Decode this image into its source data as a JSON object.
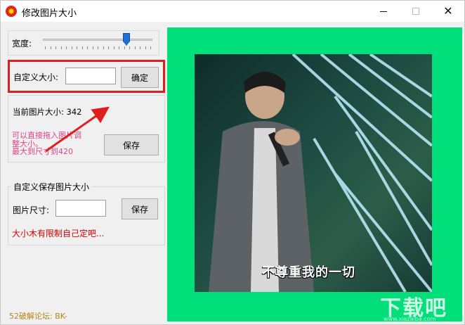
{
  "window": {
    "title": "修改图片大小"
  },
  "width_group": {
    "label": "宽度:",
    "slider_fraction": 0.76
  },
  "custom_size": {
    "label": "自定义大小:",
    "value": "",
    "confirm_label": "确定"
  },
  "current": {
    "label": "当前图片大小: 342",
    "hint_line1": "可以直接拖入图片调",
    "hint_line2": "整大小。",
    "hint_line3": "最大到尺寸到420",
    "save_label": "保存"
  },
  "custom_save": {
    "legend": "自定义保存图片大小",
    "size_label": "图片尺寸:",
    "size_value": "",
    "save_label": "保存",
    "note": "大小木有限制自己定吧..."
  },
  "footer": {
    "text": "52破解论坛:  BK-"
  },
  "preview": {
    "lyric": "不尊重我的一切",
    "watermark": "下载吧",
    "watermark_sub": "www.xiazaiba.com"
  },
  "colors": {
    "preview_bg": "#00df7a",
    "highlight_border": "#e01e1e",
    "hint_text": "#e0438a",
    "note_text": "#d40000"
  },
  "icons": {
    "app": "app-icon",
    "minimize": "minimize-icon",
    "maximize": "maximize-icon",
    "close": "close-icon"
  }
}
